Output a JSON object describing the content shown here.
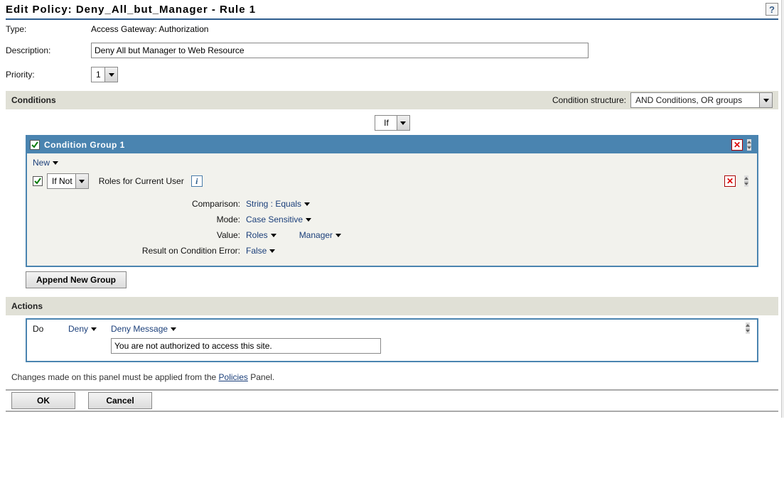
{
  "title": "Edit Policy: Deny_All_but_Manager - Rule 1",
  "help_marker": "?",
  "form": {
    "type_label": "Type:",
    "type_value": "Access Gateway: Authorization",
    "desc_label": "Description:",
    "desc_value": "Deny All but Manager to Web Resource",
    "priority_label": "Priority:",
    "priority_value": "1"
  },
  "conditions": {
    "section_title": "Conditions",
    "structure_label": "Condition structure:",
    "structure_value": "AND Conditions, OR groups",
    "if_value": "If",
    "group_title": "Condition Group 1",
    "new_link": "New",
    "ifnot_value": "If Not",
    "roles_label": "Roles for Current User",
    "rows": {
      "comparison_key": "Comparison:",
      "comparison_val": "String : Equals",
      "mode_key": "Mode:",
      "mode_val": "Case Sensitive",
      "value_key": "Value:",
      "value_val1": "Roles",
      "value_val2": "Manager",
      "error_key": "Result on Condition Error:",
      "error_val": "False"
    },
    "append_btn": "Append New Group"
  },
  "actions": {
    "section_title": "Actions",
    "do_label": "Do",
    "deny_label": "Deny",
    "deny_msg_label": "Deny Message",
    "deny_msg_value": "You are not authorized to access this site."
  },
  "footer": {
    "note_prefix": "Changes made on this panel must be applied from the ",
    "note_link": "Policies",
    "note_suffix": " Panel."
  },
  "buttons": {
    "ok": "OK",
    "cancel": "Cancel"
  },
  "icons": {
    "info": "i",
    "close_x": "✕"
  }
}
